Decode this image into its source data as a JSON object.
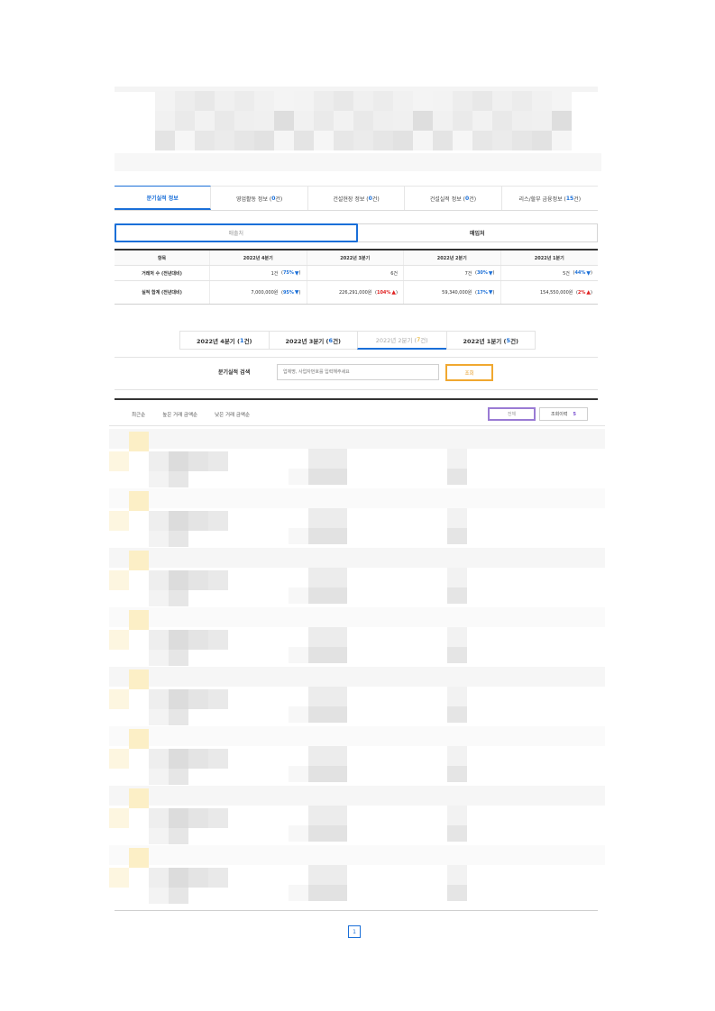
{
  "tabs": [
    {
      "label": "분기실적 정보",
      "count": "",
      "suffix": ""
    },
    {
      "label": "영업활동 정보 (",
      "count": "0",
      "suffix": "건)"
    },
    {
      "label": "건설현장 정보 (",
      "count": "0",
      "suffix": "건)"
    },
    {
      "label": "건설실적 정보 (",
      "count": "0",
      "suffix": "건)"
    },
    {
      "label": "리스/할부 금융정보 (",
      "count": "15",
      "suffix": "건)"
    }
  ],
  "segment": {
    "sales": "매출처",
    "purchase": "매입처"
  },
  "summary": {
    "headers": [
      "항목",
      "2022년 4분기",
      "2022년 3분기",
      "2022년 2분기",
      "2022년 1분기"
    ],
    "rows": [
      {
        "label": "거래처 수 (전년대비)",
        "cells": [
          {
            "value": "1건",
            "pct": "75%",
            "dir": "down"
          },
          {
            "value": "6건",
            "pct": "",
            "dir": ""
          },
          {
            "value": "7건",
            "pct": "30%",
            "dir": "down"
          },
          {
            "value": "5건",
            "pct": "44%",
            "dir": "down"
          }
        ]
      },
      {
        "label": "실적 합계 (전년대비)",
        "cells": [
          {
            "value": "7,000,000원",
            "pct": "95%",
            "dir": "down"
          },
          {
            "value": "226,291,000원",
            "pct": "104%",
            "dir": "up"
          },
          {
            "value": "59,340,000원",
            "pct": "17%",
            "dir": "down"
          },
          {
            "value": "154,550,000원",
            "pct": "2%",
            "dir": "up"
          }
        ]
      }
    ]
  },
  "quarter_tabs": [
    {
      "label": "2022년 4분기 (",
      "num": "1",
      "suffix": "건)"
    },
    {
      "label": "2022년 3분기 (",
      "num": "6",
      "suffix": "건)"
    },
    {
      "label": "2022년 2분기 (",
      "num": "7",
      "suffix": "건)"
    },
    {
      "label": "2022년 1분기 (",
      "num": "5",
      "suffix": "건)"
    }
  ],
  "search": {
    "label": "분기실적 검색",
    "placeholder": "업체명, 사업자번호를 입력해주세요",
    "button": "조회"
  },
  "sorts": [
    "최근순",
    "높은 거래 금액순",
    "낮은 거래 금액순"
  ],
  "buttons": {
    "all": "전체",
    "history": "조회이력",
    "history_count": "5"
  },
  "pagination": {
    "current": "1"
  },
  "colors": {
    "accent": "#1a6fd8",
    "up": "#e02020",
    "search_btn": "#f0a830",
    "purple": "#9a7bd4"
  }
}
